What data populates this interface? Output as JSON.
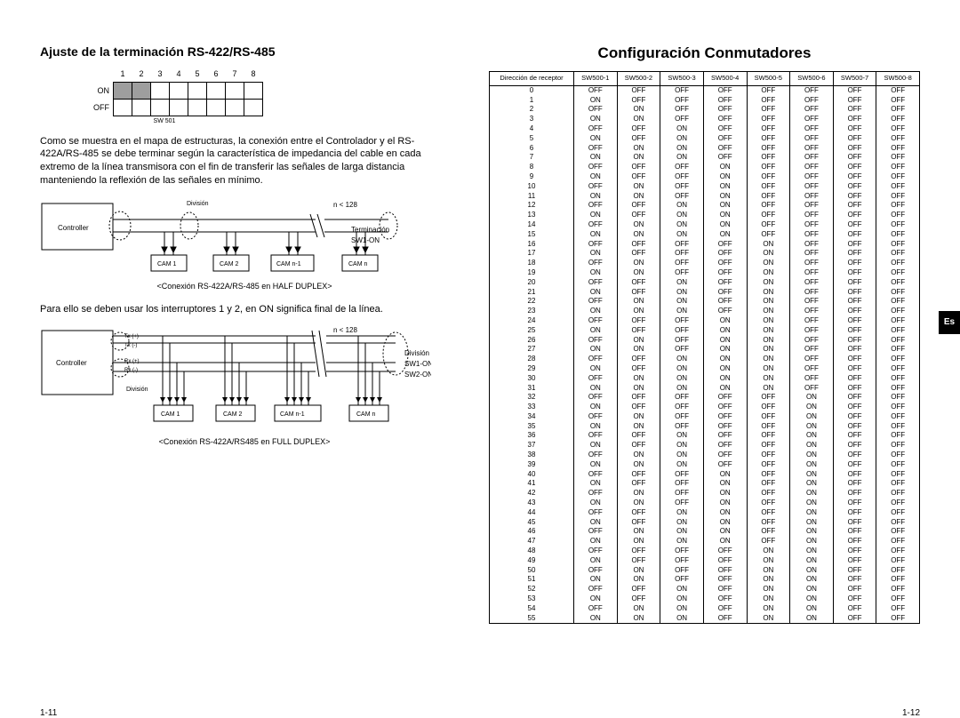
{
  "left": {
    "title": "Ajuste de la terminación RS-422/RS-485",
    "dip": {
      "numbers": [
        "1",
        "2",
        "3",
        "4",
        "5",
        "6",
        "7",
        "8"
      ],
      "on": "ON",
      "off": "OFF",
      "caption": "SW 501"
    },
    "para1": "Como se muestra en el mapa de estructuras, la conexión entre el Controlador y el RS-422A/RS-485 se debe terminar según la característica de impedancia del cable en cada extremo de la línea transmisora con el fin de transferir las señales de larga distancia manteniendo la reflexión de las señales en mínimo.",
    "dia1": {
      "box": "Controller",
      "division": "División",
      "n": "n < 128",
      "term1": "Terminación",
      "term2": "SW1-ON",
      "cam": [
        "CAM 1",
        "CAM 2",
        "CAM n-1",
        "CAM n"
      ],
      "caption": "<Conexión RS-422A/RS-485 en HALF DUPLEX>"
    },
    "para2": "Para ello se deben usar los interruptores 1 y 2, en ON significa final de la línea.",
    "dia2": {
      "box": "Controller",
      "tx_p": "Tx (+)",
      "tx_n": "Tx (-)",
      "rx_p": "Rx (+)",
      "rx_n": "Rx (-)",
      "division": "División",
      "n": "n < 128",
      "r1": "División",
      "r2": "SW1-ON",
      "r3": "SW2-ON",
      "cam": [
        "CAM 1",
        "CAM 2",
        "CAM n-1",
        "CAM n"
      ],
      "caption": "<Conexión RS-422A/RS485 en FULL DUPLEX>"
    },
    "page": "1-11"
  },
  "right": {
    "title": "Configuración Conmutadores",
    "headers": [
      "Dirección de receptor",
      "SW500-1",
      "SW500-2",
      "SW500-3",
      "SW500-4",
      "SW500-5",
      "SW500-6",
      "SW500-7",
      "SW500-8"
    ],
    "page": "1-12",
    "lang": "Es"
  }
}
